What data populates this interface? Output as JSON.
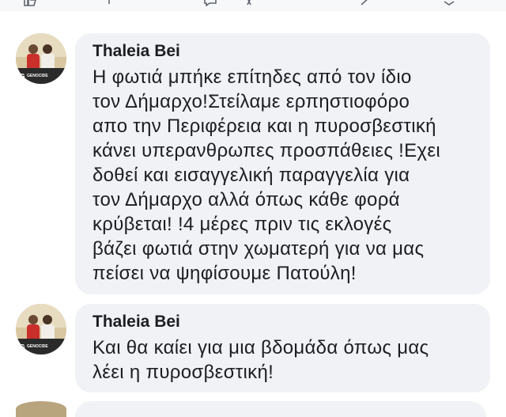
{
  "comments": [
    {
      "author": "Thaleia Bei",
      "avatar_badge": "GENOCIDE",
      "text": "Η φωτιά μπήκε επίτηδες από τον ίδιο\nτον Δήμαρχο!Στείλαμε ερπηστιοφόρο\nαπο την Περιφέρεια και η πυροσβεστική\nκάνει υπερανθρωπες προσπάθειες !Εχει\nδοθεί και εισαγγελική παραγγελία για\nτον Δήμαρχο αλλά όπως κάθε φορά\nκρύβεται! !4 μέρες πριν τις εκλογές\nβάζει φωτιά στην χωματερή για να μας\nπείσει να ψηφίσουμε Πατούλη!"
    },
    {
      "author": "Thaleia Bei",
      "avatar_badge": "GENOCIDE",
      "text": "Και θα καίει για μια βδομάδα όπως μας\nλέει η πυροσβεστική!"
    }
  ],
  "icons": [
    "like-icon",
    "comment-icon",
    "translate-icon",
    "share-icon",
    "more-icon"
  ],
  "colors": {
    "bubble": "#f0f2f5",
    "text": "#1c1e21",
    "background": "#ffffff"
  }
}
